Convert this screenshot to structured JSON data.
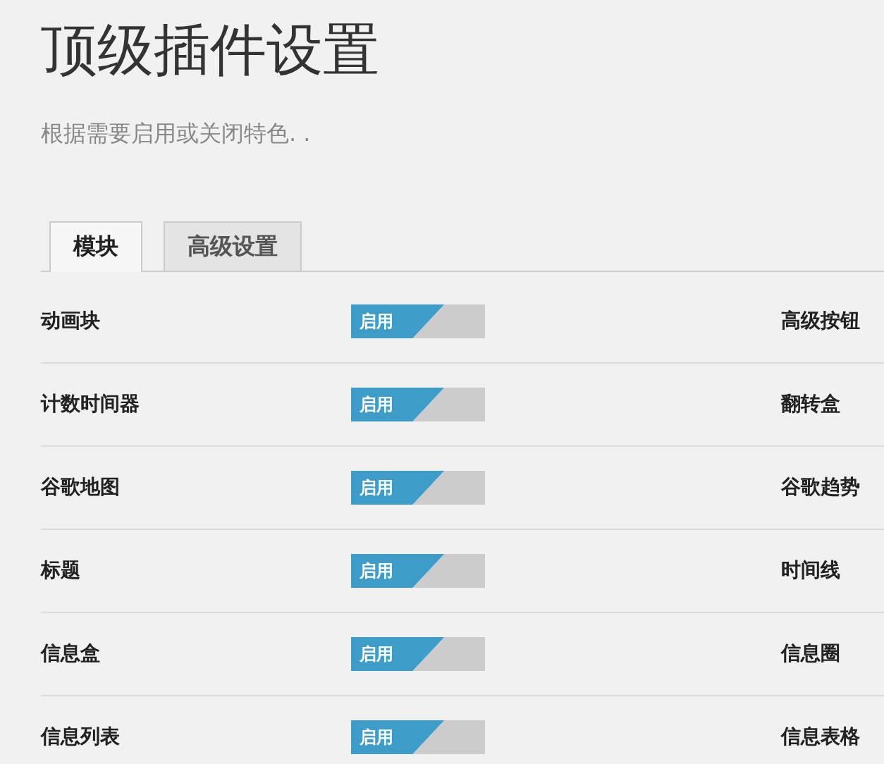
{
  "title": "顶级插件设置",
  "subtitle": "根据需要启用或关闭特色. .",
  "tabs": [
    {
      "label": "模块",
      "selected": true
    },
    {
      "label": "高级设置",
      "selected": false
    }
  ],
  "rows": [
    {
      "label": "动画块",
      "toggle": {
        "on": true,
        "label": "启用"
      },
      "right_label": "高级按钮"
    },
    {
      "label": "计数时间器",
      "toggle": {
        "on": true,
        "label": "启用"
      },
      "right_label": "翻转盒"
    },
    {
      "label": "谷歌地图",
      "toggle": {
        "on": true,
        "label": "启用"
      },
      "right_label": "谷歌趋势"
    },
    {
      "label": "标题",
      "toggle": {
        "on": true,
        "label": "启用"
      },
      "right_label": "时间线"
    },
    {
      "label": "信息盒",
      "toggle": {
        "on": true,
        "label": "启用"
      },
      "right_label": "信息圈"
    },
    {
      "label": "信息列表",
      "toggle": {
        "on": true,
        "label": "启用"
      },
      "right_label": "信息表格"
    }
  ]
}
